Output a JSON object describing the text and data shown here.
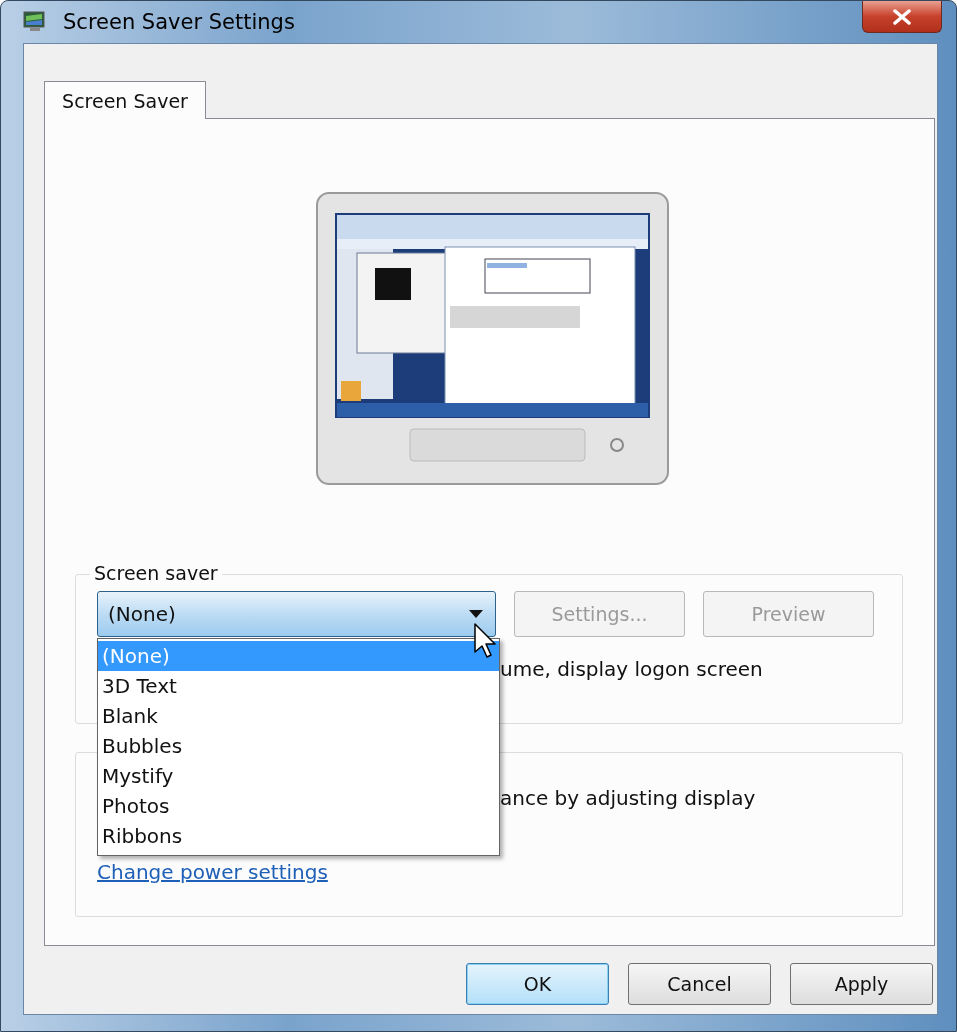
{
  "window": {
    "title": "Screen Saver Settings"
  },
  "tabs": [
    {
      "label": "Screen Saver",
      "selected": true
    }
  ],
  "screen_saver_group": {
    "label": "Screen saver",
    "combo": {
      "value": "(None)",
      "expanded": true
    },
    "buttons": [
      {
        "label": "Settings...",
        "disabled": true
      },
      {
        "label": "Preview",
        "disabled": true
      }
    ],
    "options": [
      {
        "label": "(None)",
        "selected": true
      },
      {
        "label": "3D Text",
        "selected": false
      },
      {
        "label": "Blank",
        "selected": false
      },
      {
        "label": "Bubbles",
        "selected": false
      },
      {
        "label": "Mystify",
        "selected": false
      },
      {
        "label": "Photos",
        "selected": false
      },
      {
        "label": "Ribbons",
        "selected": false
      }
    ],
    "logon_text": "ume, display logon screen"
  },
  "power_group": {
    "text": "ance by adjusting display",
    "link": "Change power settings"
  },
  "buttons": [
    {
      "label": "OK",
      "default": true
    },
    {
      "label": "Cancel",
      "default": false
    },
    {
      "label": "Apply",
      "default": false
    }
  ]
}
